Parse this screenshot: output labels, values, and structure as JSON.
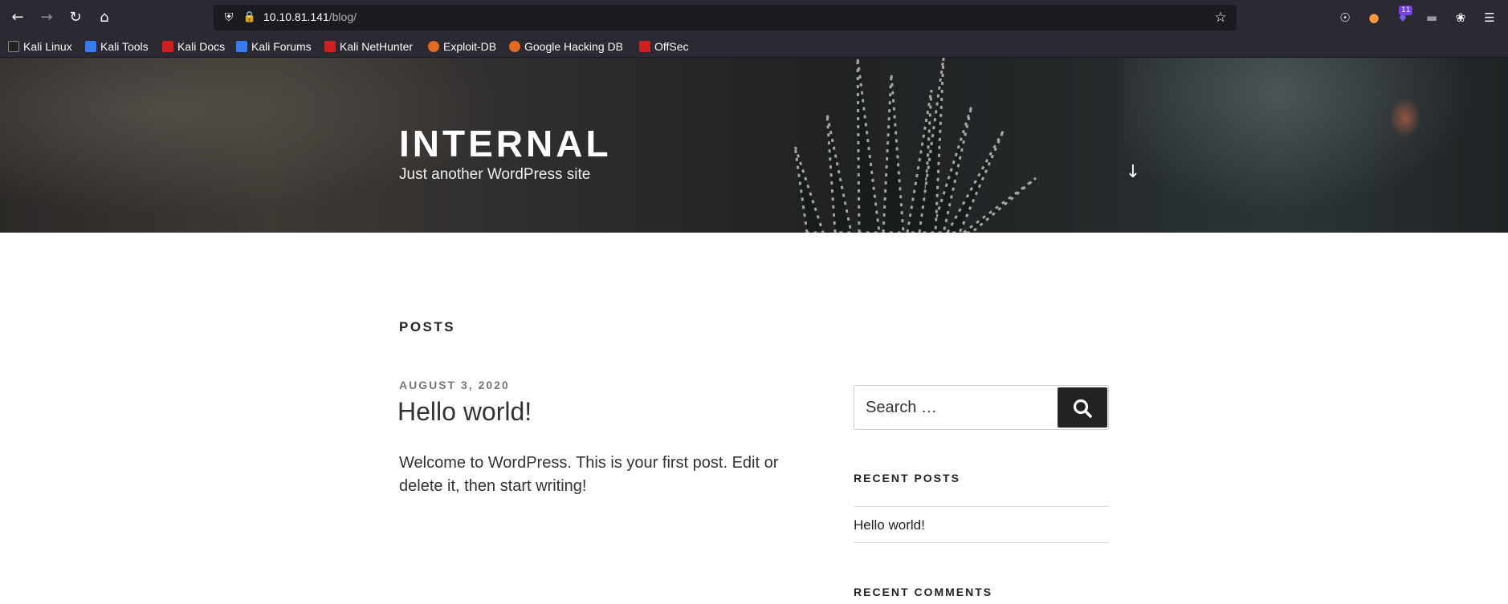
{
  "browser": {
    "url_host": "10.10.81.141",
    "url_path": "/blog/",
    "extension_badge": "11",
    "icons": {
      "back": "arrow-left-icon",
      "forward": "arrow-right-icon",
      "reload": "reload-icon",
      "home": "home-icon",
      "shield": "shield-icon",
      "lock": "lock-icon",
      "bookmark_star": "star-icon",
      "pocket": "pocket-icon",
      "menu": "hamburger-menu-icon"
    }
  },
  "bookmarks": [
    {
      "label": "Kali Linux",
      "color": "#367bf0"
    },
    {
      "label": "Kali Tools",
      "color": "#367bf0"
    },
    {
      "label": "Kali Docs",
      "color": "#d11f1f"
    },
    {
      "label": "Kali Forums",
      "color": "#367bf0"
    },
    {
      "label": "Kali NetHunter",
      "color": "#d11f1f"
    },
    {
      "label": "Exploit-DB",
      "color": "#e46a1d"
    },
    {
      "label": "Google Hacking DB",
      "color": "#e46a1d"
    },
    {
      "label": "OffSec",
      "color": "#d11f1f"
    }
  ],
  "site": {
    "title": "INTERNAL",
    "description": "Just another WordPress site"
  },
  "content": {
    "section_heading": "POSTS",
    "post": {
      "date": "AUGUST 3, 2020",
      "title": "Hello world!",
      "excerpt": "Welcome to WordPress. This is your first post. Edit or delete it, then start writing!"
    }
  },
  "sidebar": {
    "search_placeholder": "Search …",
    "recent_posts_title": "RECENT POSTS",
    "recent_posts": [
      "Hello world!"
    ],
    "recent_comments_title": "RECENT COMMENTS"
  }
}
